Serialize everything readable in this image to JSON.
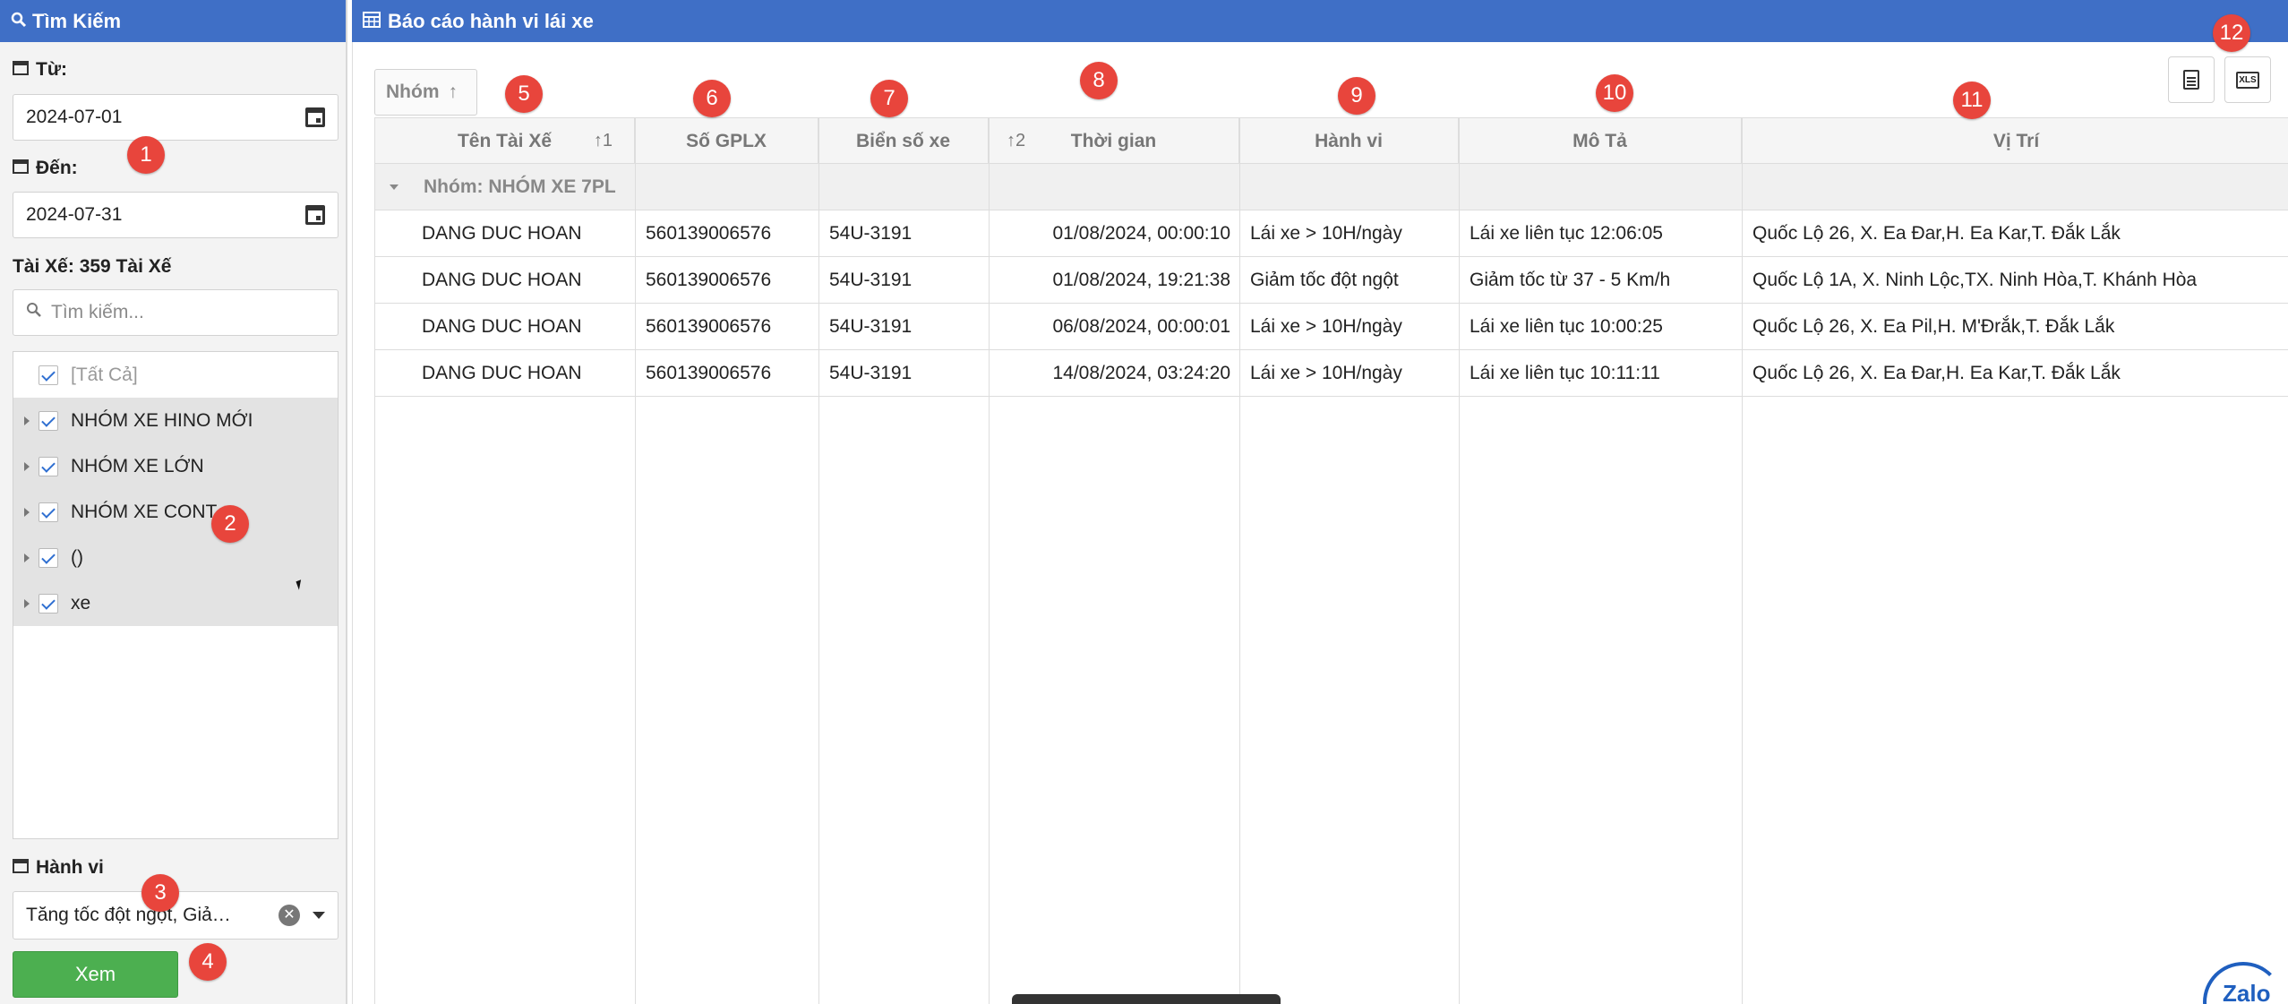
{
  "left_panel": {
    "title": "Tìm Kiếm",
    "from_label": "Từ:",
    "from_value": "2024-07-01",
    "to_label": "Đến:",
    "to_value": "2024-07-31",
    "driver_label": "Tài Xế: 359 Tài Xế",
    "search_placeholder": "Tìm kiếm...",
    "tree": {
      "all": "[Tất Cả]",
      "groups": [
        "NHÓM XE HINO MỚI",
        "NHÓM XE LỚN",
        "NHÓM XE CONT",
        "()",
        "xe"
      ]
    },
    "behavior_label": "Hành vi",
    "behavior_value": "Tăng tốc đột ngột, Giả…",
    "view_button": "Xem"
  },
  "report": {
    "title": "Báo cáo hành vi lái xe",
    "group_chip": "Nhóm",
    "columns": [
      "Tên Tài Xế",
      "Số GPLX",
      "Biển số xe",
      "Thời gian",
      "Hành vi",
      "Mô Tả",
      "Vị Trí"
    ],
    "sort_index_1": "1",
    "sort_index_2": "2",
    "group_row": "Nhóm: NHÓM XE 7PL",
    "rows": [
      [
        "DANG DUC HOAN",
        "560139006576",
        "54U-3191",
        "01/08/2024, 00:00:10",
        "Lái xe > 10H/ngày",
        "Lái xe liên tục 12:06:05",
        "Quốc Lộ 26, X. Ea Đar,H. Ea Kar,T. Đắk Lắk"
      ],
      [
        "DANG DUC HOAN",
        "560139006576",
        "54U-3191",
        "01/08/2024, 19:21:38",
        "Giảm tốc đột ngột",
        "Giảm tốc từ 37 - 5 Km/h",
        "Quốc Lộ 1A, X. Ninh Lộc,TX. Ninh Hòa,T. Khánh Hòa"
      ],
      [
        "DANG DUC HOAN",
        "560139006576",
        "54U-3191",
        "06/08/2024, 00:00:01",
        "Lái xe > 10H/ngày",
        "Lái xe liên tục 10:00:25",
        "Quốc Lộ 26, X. Ea Pil,H. M'Đrắk,T. Đắk Lắk"
      ],
      [
        "DANG DUC HOAN",
        "560139006576",
        "54U-3191",
        "14/08/2024, 03:24:20",
        "Lái xe > 10H/ngày",
        "Lái xe liên tục 10:11:11",
        "Quốc Lộ 26, X. Ea Đar,H. Ea Kar,T. Đắk Lắk"
      ]
    ]
  },
  "annotations": [
    "1",
    "2",
    "3",
    "4",
    "5",
    "6",
    "7",
    "8",
    "9",
    "10",
    "11",
    "12"
  ],
  "watermark": "Zalo",
  "colors": {
    "header_blue": "#3f6fc6",
    "badge_red": "#e8453c",
    "button_green": "#4caf50"
  },
  "icons": [
    "search-icon",
    "calendar-icon",
    "date-picker-icon",
    "checkbox-icon",
    "clear-icon",
    "dropdown-icon",
    "sort-icon",
    "export-pdf-icon",
    "export-xlsx-icon",
    "table-icon"
  ]
}
